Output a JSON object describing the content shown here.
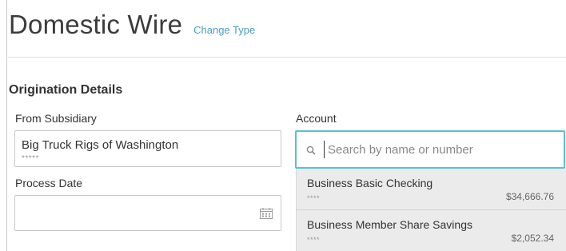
{
  "header": {
    "title": "Domestic Wire",
    "change_type_label": "Change Type"
  },
  "origination": {
    "section_title": "Origination Details",
    "from_subsidiary": {
      "label": "From Subsidiary",
      "value": "Big Truck Rigs of Washington",
      "mask": "*****"
    },
    "process_date": {
      "label": "Process Date",
      "value": "",
      "icon": "calendar-icon"
    },
    "account": {
      "label": "Account",
      "search_placeholder": "Search by name or number",
      "search_value": "",
      "icon": "search-icon",
      "options": [
        {
          "name": "Business Basic Checking",
          "mask": "****",
          "balance": "$34,666.76"
        },
        {
          "name": "Business Member Share Savings",
          "mask": "****",
          "balance": "$2,052.34"
        }
      ]
    }
  },
  "colors": {
    "link": "#4a9dc4",
    "focus_border": "#5bbfd4",
    "dropdown_bg": "#ebebeb"
  }
}
